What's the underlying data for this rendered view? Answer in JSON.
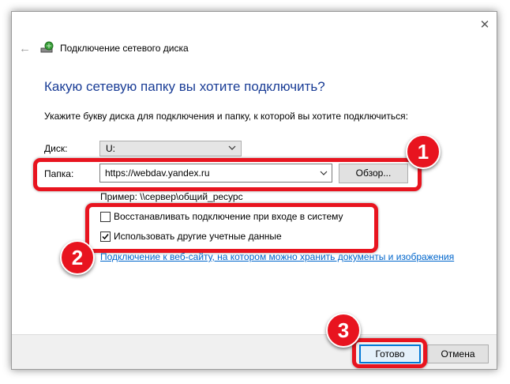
{
  "window": {
    "title": "Подключение сетевого диска",
    "close_glyph": "✕",
    "back_glyph": "←"
  },
  "content": {
    "heading": "Какую сетевую папку вы хотите подключить?",
    "instruction": "Укажите букву диска для подключения и папку, к которой вы хотите подключиться:",
    "drive_label": "Диск:",
    "drive_value": "U:",
    "folder_label": "Папка:",
    "folder_value": "https://webdav.yandex.ru",
    "browse_label": "Обзор...",
    "example": "Пример: \\\\сервер\\общий_ресурс",
    "checkbox_reconnect": {
      "label": "Восстанавливать подключение при входе в систему",
      "checked": false
    },
    "checkbox_credentials": {
      "label": "Использовать другие учетные данные",
      "checked": true
    },
    "link": "Подключение к веб-сайту, на котором можно хранить документы и изображения"
  },
  "footer": {
    "ok_label": "Готово",
    "cancel_label": "Отмена"
  },
  "annotations": {
    "color": "#e8141f",
    "badges": [
      "1",
      "2",
      "3"
    ]
  }
}
